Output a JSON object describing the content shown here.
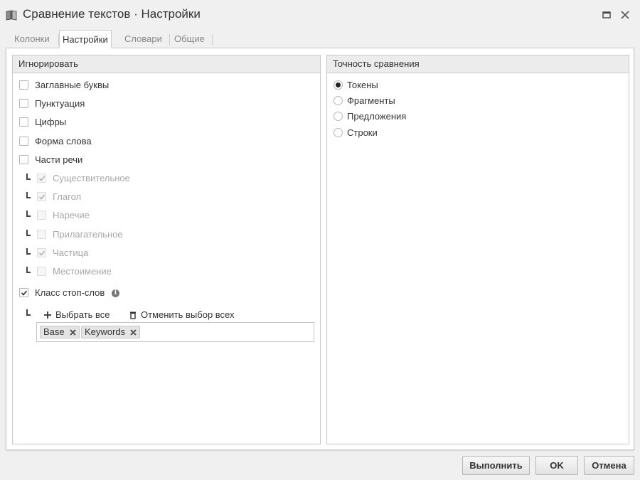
{
  "window": {
    "title": "Сравнение текстов · Настройки",
    "icon": "book-icon",
    "maximize_icon": "maximize-icon",
    "close_icon": "close-icon"
  },
  "tabs": [
    {
      "label": "Колонки",
      "active": false
    },
    {
      "label": "Настройки",
      "active": true
    },
    {
      "label": "Словари",
      "active": false
    },
    {
      "label": "Общие",
      "active": false
    }
  ],
  "ignore_panel": {
    "header": "Игнорировать",
    "options": [
      {
        "label": "Заглавные буквы",
        "checked": false
      },
      {
        "label": "Пунктуация",
        "checked": false
      },
      {
        "label": "Цифры",
        "checked": false
      },
      {
        "label": "Форма слова",
        "checked": false
      },
      {
        "label": "Части речи",
        "checked": false
      }
    ],
    "parts_of_speech": [
      {
        "label": "Существительное",
        "checked": true,
        "disabled": true
      },
      {
        "label": "Глагол",
        "checked": true,
        "disabled": true
      },
      {
        "label": "Наречие",
        "checked": false,
        "disabled": true
      },
      {
        "label": "Прилагательное",
        "checked": false,
        "disabled": true
      },
      {
        "label": "Частица",
        "checked": true,
        "disabled": true
      },
      {
        "label": "Местоимение",
        "checked": false,
        "disabled": true
      }
    ],
    "stopword_class": {
      "label": "Класс стоп-слов",
      "checked": true,
      "info_icon": "info-icon"
    },
    "select_all_label": "Выбрать все",
    "deselect_all_label": "Отменить выбор всех",
    "tags": [
      "Base",
      "Keywords"
    ]
  },
  "accuracy_panel": {
    "header": "Точность сравнения",
    "options": [
      {
        "label": "Токены",
        "selected": true
      },
      {
        "label": "Фрагменты",
        "selected": false
      },
      {
        "label": "Предложения",
        "selected": false
      },
      {
        "label": "Строки",
        "selected": false
      }
    ]
  },
  "buttons": {
    "run": "Выполнить",
    "ok": "OK",
    "cancel": "Отмена"
  }
}
